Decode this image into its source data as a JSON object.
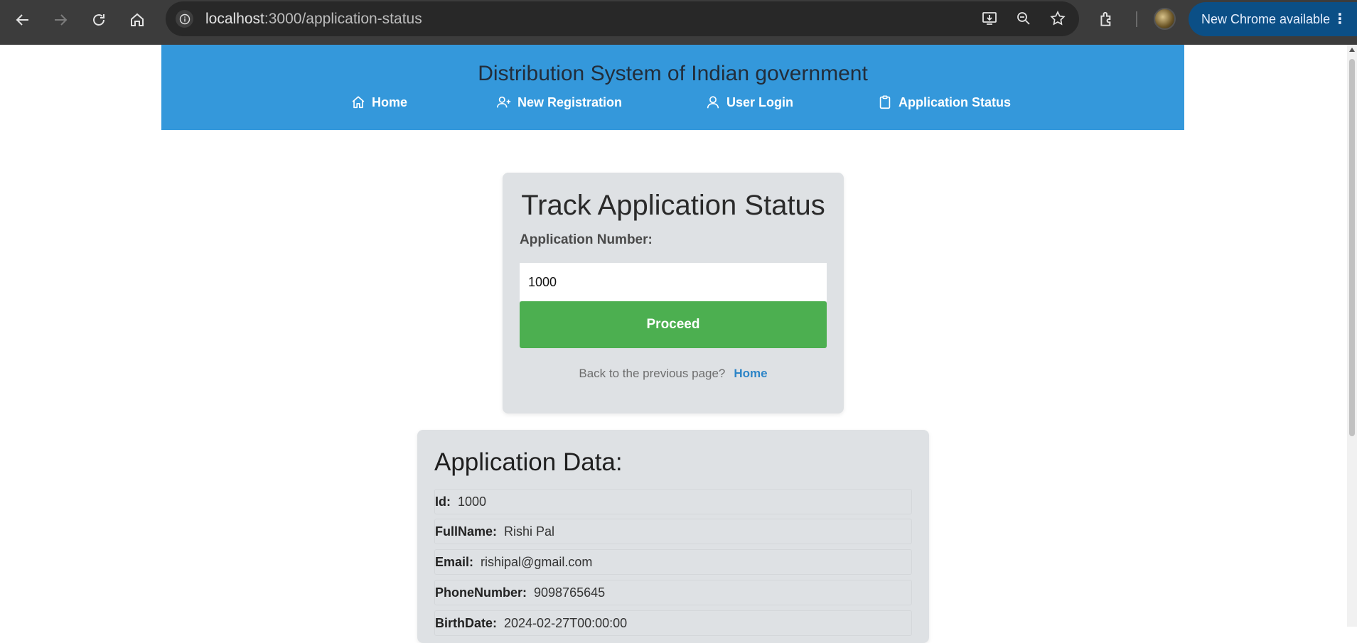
{
  "browser": {
    "url_host": "localhost",
    "url_path": ":3000/application-status",
    "update_label": "New Chrome available",
    "update_menu": "⋮"
  },
  "header": {
    "title": "Distribution System of Indian government",
    "nav": [
      {
        "label": "Home",
        "icon": "home-icon"
      },
      {
        "label": "New Registration",
        "icon": "user-plus-icon"
      },
      {
        "label": "User Login",
        "icon": "user-icon"
      },
      {
        "label": "Application Status",
        "icon": "clipboard-icon"
      }
    ]
  },
  "track": {
    "title": "Track Application Status",
    "label": "Application Number:",
    "value": "1000",
    "button": "Proceed",
    "back_text": "Back to the previous page?",
    "back_link": "Home"
  },
  "data": {
    "title": "Application Data:",
    "rows": [
      {
        "key": "Id:",
        "value": "1000"
      },
      {
        "key": "FullName:",
        "value": "Rishi Pal"
      },
      {
        "key": "Email:",
        "value": "rishipal@gmail.com"
      },
      {
        "key": "PhoneNumber:",
        "value": "9098765645"
      },
      {
        "key": "BirthDate:",
        "value": "2024-02-27T00:00:00"
      }
    ]
  },
  "colors": {
    "header_bg": "#3498db",
    "button_bg": "#4caf50",
    "card_bg": "#dee1e4",
    "link": "#2d85c7"
  }
}
